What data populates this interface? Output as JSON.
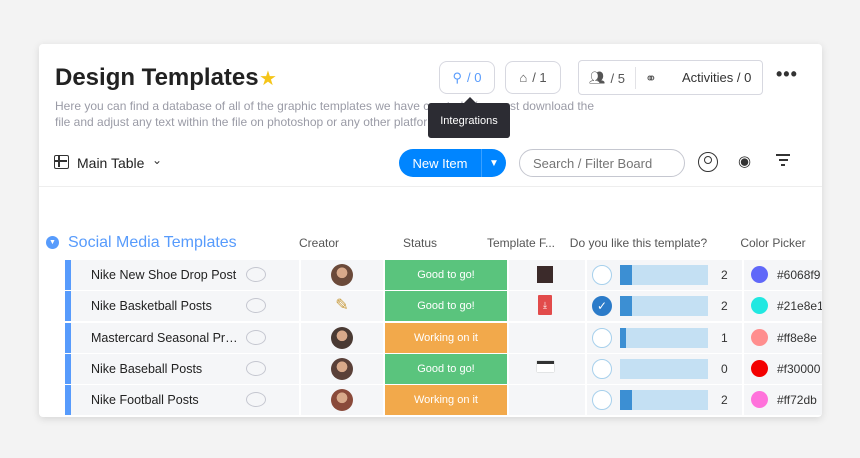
{
  "header": {
    "title": "Design Templates",
    "star_icon": "star-icon",
    "description": "Here you can find a database of all of the graphic templates we have created. You must download the file and adjust any text within the file on photoshop or any other platform.",
    "integrations_count": "/ 0",
    "automations_count": "/ 1",
    "members_count": "/ 5",
    "activities_label": "Activities / 0",
    "more_label": "•••",
    "tooltip": "Integrations"
  },
  "toolbar": {
    "view_label": "Main Table",
    "new_item_label": "New Item",
    "search_placeholder": "Search / Filter Board"
  },
  "group": {
    "title": "Social Media Templates",
    "color": "#579bfc",
    "columns": [
      "Creator",
      "Status",
      "Template F...",
      "Do you like this template?",
      "Color Picker"
    ]
  },
  "rows": [
    {
      "name": "Nike New Shoe Drop Post",
      "status": "Good to go!",
      "status_color": "#5ac47d",
      "liked": false,
      "fill": 0.14,
      "count": "2",
      "color": "#6068f9",
      "color_label": "#6068f9",
      "avatar": "#6b4a3a",
      "file": "thumb"
    },
    {
      "name": "Nike Basketball Posts",
      "status": "Good to go!",
      "status_color": "#5ac47d",
      "liked": true,
      "fill": 0.14,
      "count": "2",
      "color": "#21e8e1",
      "color_label": "#21e8e1",
      "avatar": "pencil",
      "file": "pdf"
    },
    {
      "name": "Mastercard Seasonal Promo Posts",
      "status": "Working on it",
      "status_color": "#f2a94b",
      "liked": false,
      "fill": 0.07,
      "count": "1",
      "color": "#ff8e8e",
      "color_label": "#ff8e8e",
      "avatar": "#4a3a33",
      "file": ""
    },
    {
      "name": "Nike Baseball Posts",
      "status": "Good to go!",
      "status_color": "#5ac47d",
      "liked": false,
      "fill": 0.0,
      "count": "0",
      "color": "#f30000",
      "color_label": "#f30000",
      "avatar": "#5a4038",
      "file": "thumb2"
    },
    {
      "name": "Nike Football Posts",
      "status": "Working on it",
      "status_color": "#f2a94b",
      "liked": false,
      "fill": 0.14,
      "count": "2",
      "color": "#ff72db",
      "color_label": "#ff72db",
      "avatar": "#8a4a3a",
      "file": ""
    }
  ]
}
